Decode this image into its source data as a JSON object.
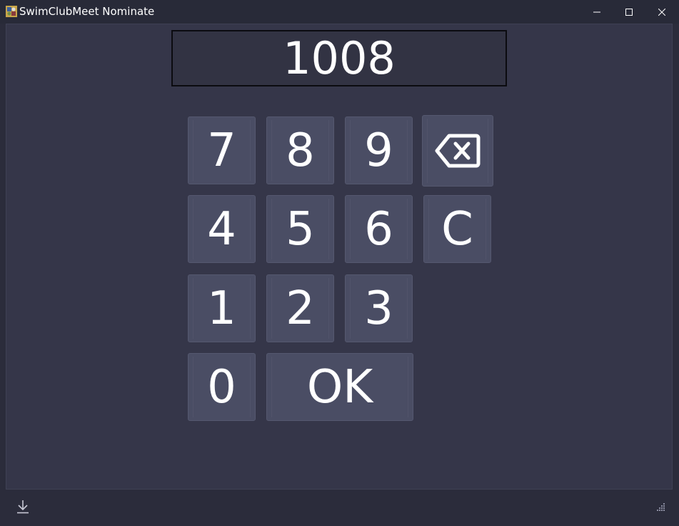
{
  "window": {
    "title": "SwimClubMeet Nominate",
    "controls": [
      "minimize-icon",
      "maximize-icon",
      "close-icon"
    ]
  },
  "display": {
    "value": "1008"
  },
  "keypad": {
    "keys": [
      {
        "label": "7"
      },
      {
        "label": "8"
      },
      {
        "label": "9"
      },
      {
        "label": "4"
      },
      {
        "label": "5"
      },
      {
        "label": "6"
      },
      {
        "label": "1"
      },
      {
        "label": "2"
      },
      {
        "label": "3"
      },
      {
        "label": "0"
      }
    ],
    "backspace_icon": "backspace-icon",
    "clear_label": "C",
    "ok_label": "OK"
  },
  "statusbar": {
    "left_icon": "download-icon",
    "right_icon": "resize-grip-icon"
  },
  "colors": {
    "background": "#353649",
    "titlebar": "#282a38",
    "key": "#4a4d64",
    "text": "#ffffff"
  }
}
